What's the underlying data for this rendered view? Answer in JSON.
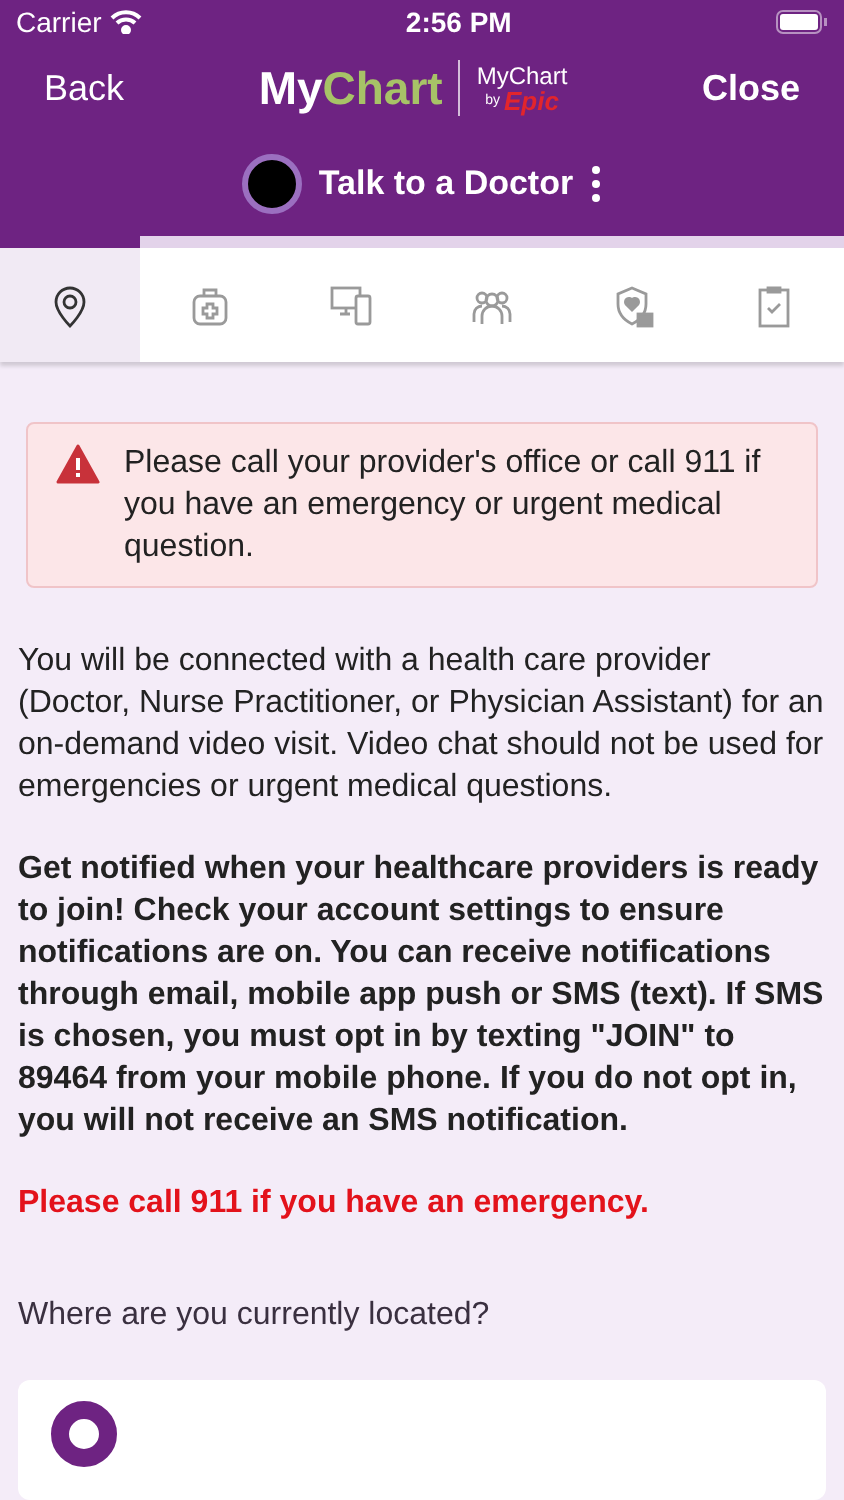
{
  "status_bar": {
    "carrier": "Carrier",
    "time": "2:56 PM"
  },
  "nav": {
    "back": "Back",
    "logo": "MyChart",
    "logo_small": "MyChart",
    "logo_by": "by",
    "logo_epic": "Epic",
    "close": "Close"
  },
  "title": "Talk to a Doctor",
  "progress": {
    "level": 0.167
  },
  "steps": [
    {
      "kind": "location",
      "selected": true
    },
    {
      "kind": "medkit",
      "selected": false
    },
    {
      "kind": "devices",
      "selected": false
    },
    {
      "kind": "people",
      "selected": false
    },
    {
      "kind": "shield",
      "selected": false
    },
    {
      "kind": "clipboard",
      "selected": false
    }
  ],
  "alert": "Please call your provider's office or call 911 if you have an emergency or urgent medical question.",
  "paragraphs": [
    {
      "kind": "normal",
      "text": "You will be connected with a health care provider (Doctor, Nurse Practitioner, or Physician Assistant) for an on-demand video visit. Video chat should not be used for emergencies or urgent medical questions."
    },
    {
      "kind": "bold",
      "text": "Get notified when your healthcare providers is ready to join! Check your account settings to ensure notifications are on. You can receive notifications through email, mobile app push or SMS (text). If SMS is chosen, you must opt in by texting \"JOIN\" to 89464 from your mobile phone. If you do not opt in, you will not receive an SMS notification."
    },
    {
      "kind": "warning",
      "text": "Please call 911 if you have an emergency."
    }
  ],
  "question": "Where are you currently located?"
}
